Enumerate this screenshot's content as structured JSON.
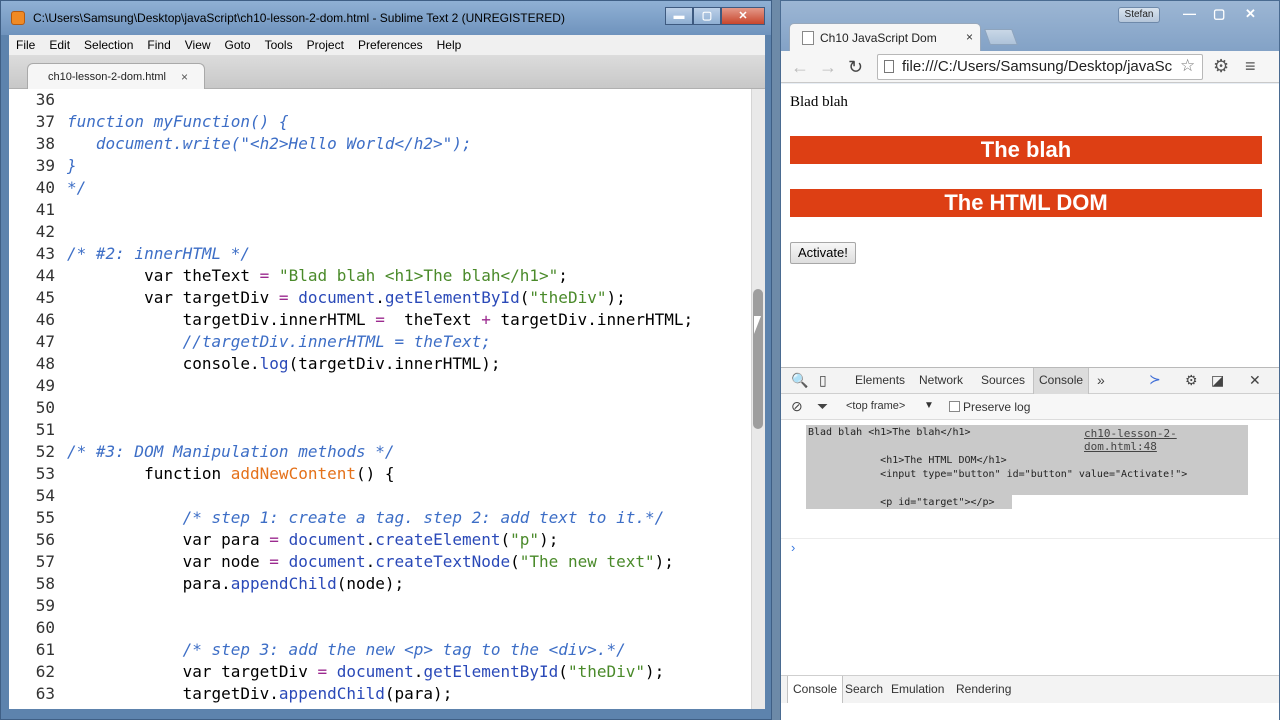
{
  "sublime": {
    "title": "C:\\Users\\Samsung\\Desktop\\javaScript\\ch10-lesson-2-dom.html - Sublime Text 2 (UNREGISTERED)",
    "menu": [
      "File",
      "Edit",
      "Selection",
      "Find",
      "View",
      "Goto",
      "Tools",
      "Project",
      "Preferences",
      "Help"
    ],
    "tab": {
      "label": "ch10-lesson-2-dom.html",
      "close": "×"
    },
    "window_controls": {
      "minimize": "▬",
      "maximize": "▢",
      "close": "✕"
    },
    "lines": [
      {
        "n": "36",
        "code": []
      },
      {
        "n": "37",
        "code": [
          {
            "c": "cm",
            "t": "function myFunction() {"
          }
        ]
      },
      {
        "n": "38",
        "code": [
          {
            "c": "cm",
            "t": "   document.write(\"<h2>Hello World</h2>\");"
          }
        ]
      },
      {
        "n": "39",
        "code": [
          {
            "c": "cm",
            "t": "}"
          }
        ]
      },
      {
        "n": "40",
        "code": [
          {
            "c": "cm",
            "t": "*/"
          }
        ]
      },
      {
        "n": "41",
        "code": []
      },
      {
        "n": "42",
        "code": []
      },
      {
        "n": "43",
        "code": [
          {
            "c": "cm",
            "t": "/* #2: innerHTML */"
          }
        ]
      },
      {
        "n": "44",
        "code": [
          {
            "c": "kw",
            "t": "        var "
          },
          {
            "c": "",
            "t": "theText "
          },
          {
            "c": "op",
            "t": "="
          },
          {
            "c": "",
            "t": " "
          },
          {
            "c": "str",
            "t": "\"Blad blah <h1>The blah</h1>\""
          },
          {
            "c": "",
            "t": ";"
          }
        ]
      },
      {
        "n": "45",
        "code": [
          {
            "c": "kw",
            "t": "        var "
          },
          {
            "c": "",
            "t": "targetDiv "
          },
          {
            "c": "op",
            "t": "="
          },
          {
            "c": "",
            "t": " "
          },
          {
            "c": "fn",
            "t": "document"
          },
          {
            "c": "",
            "t": "."
          },
          {
            "c": "fn",
            "t": "getElementById"
          },
          {
            "c": "",
            "t": "("
          },
          {
            "c": "str",
            "t": "\"theDiv\""
          },
          {
            "c": "",
            "t": ");"
          }
        ]
      },
      {
        "n": "46",
        "code": [
          {
            "c": "",
            "t": "            targetDiv.innerHTML "
          },
          {
            "c": "op",
            "t": "="
          },
          {
            "c": "",
            "t": "  theText "
          },
          {
            "c": "op",
            "t": "+"
          },
          {
            "c": "",
            "t": " targetDiv.innerHTML;"
          }
        ]
      },
      {
        "n": "47",
        "code": [
          {
            "c": "cm",
            "t": "            //targetDiv.innerHTML = theText;"
          }
        ]
      },
      {
        "n": "48",
        "code": [
          {
            "c": "",
            "t": "            console."
          },
          {
            "c": "fn",
            "t": "log"
          },
          {
            "c": "",
            "t": "(targetDiv.innerHTML);"
          }
        ]
      },
      {
        "n": "49",
        "code": []
      },
      {
        "n": "50",
        "code": []
      },
      {
        "n": "51",
        "code": []
      },
      {
        "n": "52",
        "code": [
          {
            "c": "cm",
            "t": "/* #3: DOM Manipulation methods */"
          }
        ]
      },
      {
        "n": "53",
        "code": [
          {
            "c": "kw",
            "t": "        function "
          },
          {
            "c": "nf",
            "t": "addNewContent"
          },
          {
            "c": "",
            "t": "() {"
          }
        ]
      },
      {
        "n": "54",
        "code": []
      },
      {
        "n": "55",
        "code": [
          {
            "c": "cm",
            "t": "            /* step 1: create a tag. step 2: add text to it.*/"
          }
        ]
      },
      {
        "n": "56",
        "code": [
          {
            "c": "kw",
            "t": "            var "
          },
          {
            "c": "",
            "t": "para "
          },
          {
            "c": "op",
            "t": "="
          },
          {
            "c": "",
            "t": " "
          },
          {
            "c": "fn",
            "t": "document"
          },
          {
            "c": "",
            "t": "."
          },
          {
            "c": "fn",
            "t": "createElement"
          },
          {
            "c": "",
            "t": "("
          },
          {
            "c": "str",
            "t": "\"p\""
          },
          {
            "c": "",
            "t": ");"
          }
        ]
      },
      {
        "n": "57",
        "code": [
          {
            "c": "kw",
            "t": "            var "
          },
          {
            "c": "",
            "t": "node "
          },
          {
            "c": "op",
            "t": "="
          },
          {
            "c": "",
            "t": " "
          },
          {
            "c": "fn",
            "t": "document"
          },
          {
            "c": "",
            "t": "."
          },
          {
            "c": "fn",
            "t": "createTextNode"
          },
          {
            "c": "",
            "t": "("
          },
          {
            "c": "str",
            "t": "\"The new text\""
          },
          {
            "c": "",
            "t": ");"
          }
        ]
      },
      {
        "n": "58",
        "code": [
          {
            "c": "",
            "t": "            para."
          },
          {
            "c": "fn",
            "t": "appendChild"
          },
          {
            "c": "",
            "t": "(node);"
          }
        ]
      },
      {
        "n": "59",
        "code": []
      },
      {
        "n": "60",
        "code": []
      },
      {
        "n": "61",
        "code": [
          {
            "c": "cm",
            "t": "            /* step 3: add the new <p> tag to the <div>.*/"
          }
        ]
      },
      {
        "n": "62",
        "code": [
          {
            "c": "kw",
            "t": "            var "
          },
          {
            "c": "",
            "t": "targetDiv "
          },
          {
            "c": "op",
            "t": "="
          },
          {
            "c": "",
            "t": " "
          },
          {
            "c": "fn",
            "t": "document"
          },
          {
            "c": "",
            "t": "."
          },
          {
            "c": "fn",
            "t": "getElementById"
          },
          {
            "c": "",
            "t": "("
          },
          {
            "c": "str",
            "t": "\"theDiv\""
          },
          {
            "c": "",
            "t": ");"
          }
        ]
      },
      {
        "n": "63",
        "code": [
          {
            "c": "",
            "t": "            targetDiv."
          },
          {
            "c": "fn",
            "t": "appendChild"
          },
          {
            "c": "",
            "t": "(para);"
          }
        ]
      }
    ]
  },
  "chrome": {
    "user": "Stefan",
    "window_controls": {
      "minimize": "—",
      "maximize": "▢",
      "close": "✕"
    },
    "tab": {
      "label": "Ch10 JavaScript Dom",
      "close": "×"
    },
    "nav": {
      "back": "←",
      "forward": "→",
      "reload": "↻"
    },
    "url": "file:///C:/Users/Samsung/Desktop/javaScript/ch10-lesson-2-dom.html",
    "icons": {
      "star": "☆",
      "settings": "⚙",
      "menu": "≡"
    },
    "page": {
      "text": "Blad blah",
      "heading1": "The blah",
      "heading2": "The HTML DOM",
      "button": "Activate!"
    },
    "devtools": {
      "icons": {
        "search": "🔍",
        "device": "▯",
        "more": "»",
        "drawer": "≻",
        "settings": "⚙",
        "dock": "◪",
        "close": "✕",
        "clear": "⊘",
        "filter": "⏷"
      },
      "tabs": [
        "Elements",
        "Network",
        "Sources",
        "Console"
      ],
      "selected_tab": "Console",
      "frame": "<top frame>",
      "frame_arrow": "▼",
      "preserve_log": "Preserve log",
      "output": {
        "line1": "Blad blah <h1>The blah</h1>",
        "line2": "         <h1>The HTML DOM</h1>",
        "line3": "         <input type=\"button\" id=\"button\" value=\"Activate!\">",
        "line4": "         <p id=\"target\"></p>",
        "source": "ch10-lesson-2-dom.html:48"
      },
      "prompt": "›",
      "drawer_tabs": [
        "Console",
        "Search",
        "Emulation",
        "Rendering"
      ]
    }
  }
}
